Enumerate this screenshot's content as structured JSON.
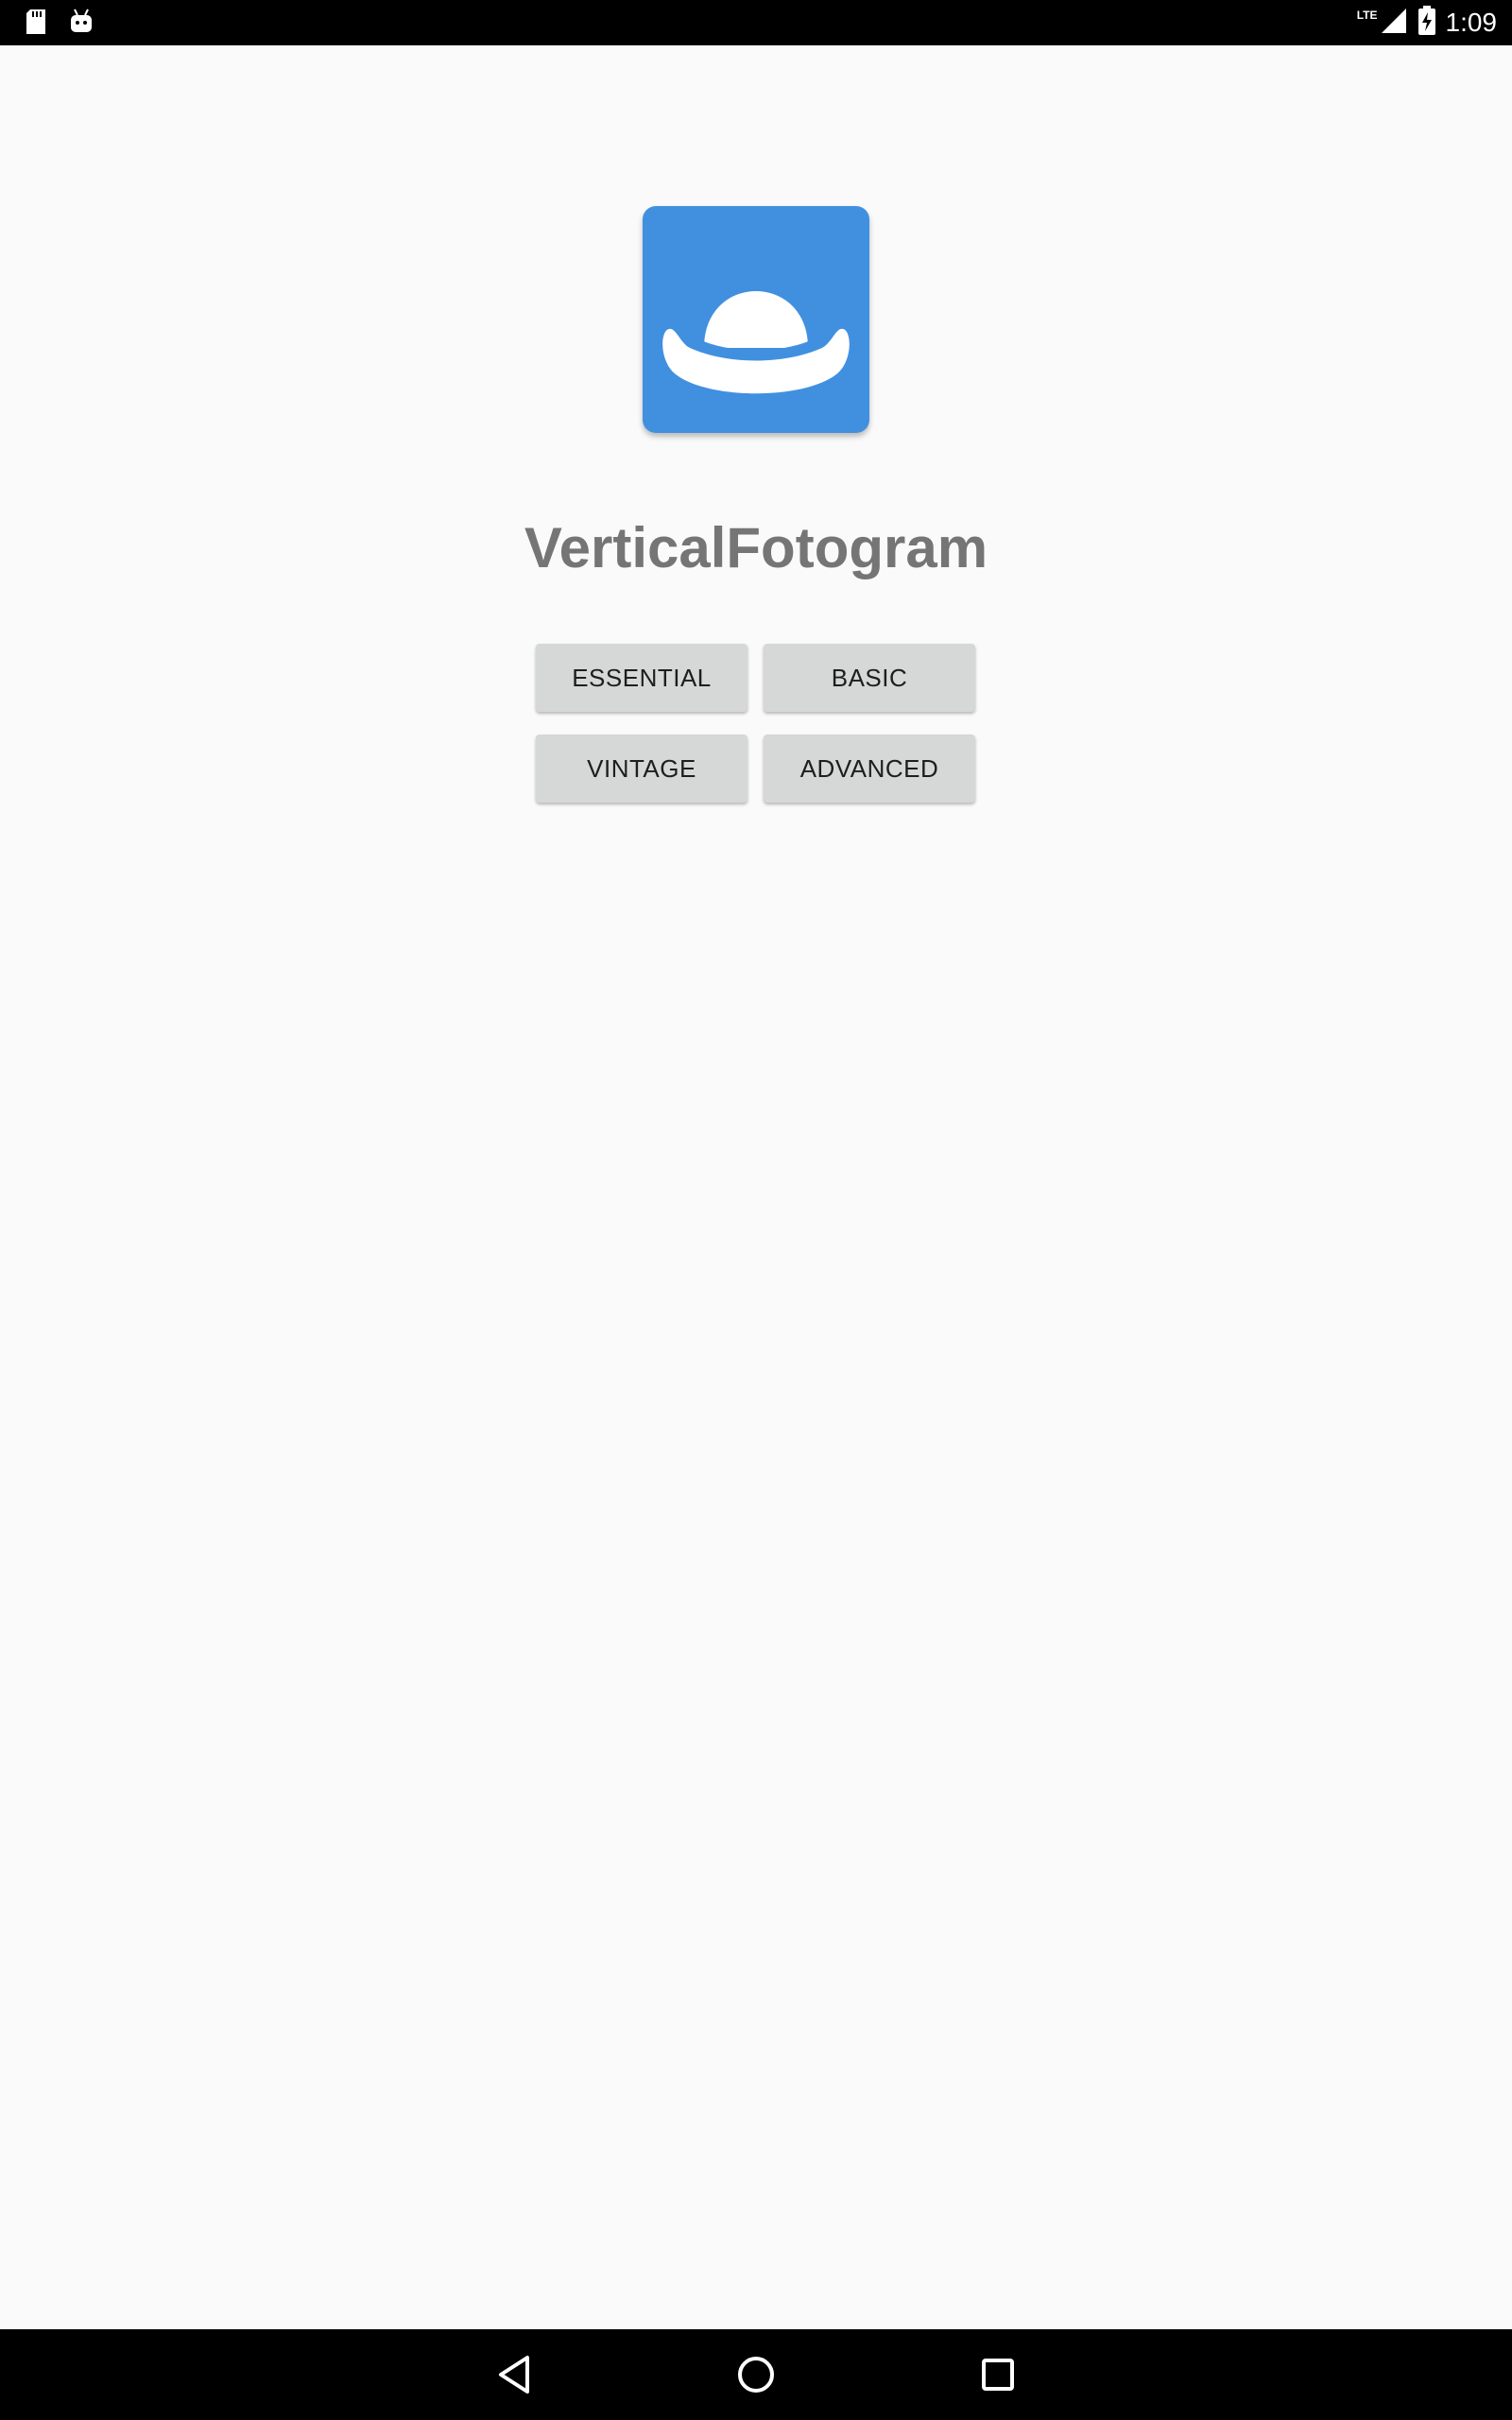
{
  "status_bar": {
    "time": "1:09",
    "network": "LTE",
    "left_icons": [
      "sd-card-icon",
      "android-icon"
    ],
    "right_icons": [
      "signal-icon",
      "battery-charging-icon"
    ]
  },
  "app": {
    "title": "VerticalFotogram",
    "icon": "bowler-hat-icon",
    "icon_color": "#4190e0"
  },
  "buttons": {
    "essential": "ESSENTIAL",
    "basic": "BASIC",
    "vintage": "VINTAGE",
    "advanced": "ADVANCED"
  },
  "nav_bar": {
    "icons": [
      "back-icon",
      "home-icon",
      "recents-icon"
    ]
  }
}
